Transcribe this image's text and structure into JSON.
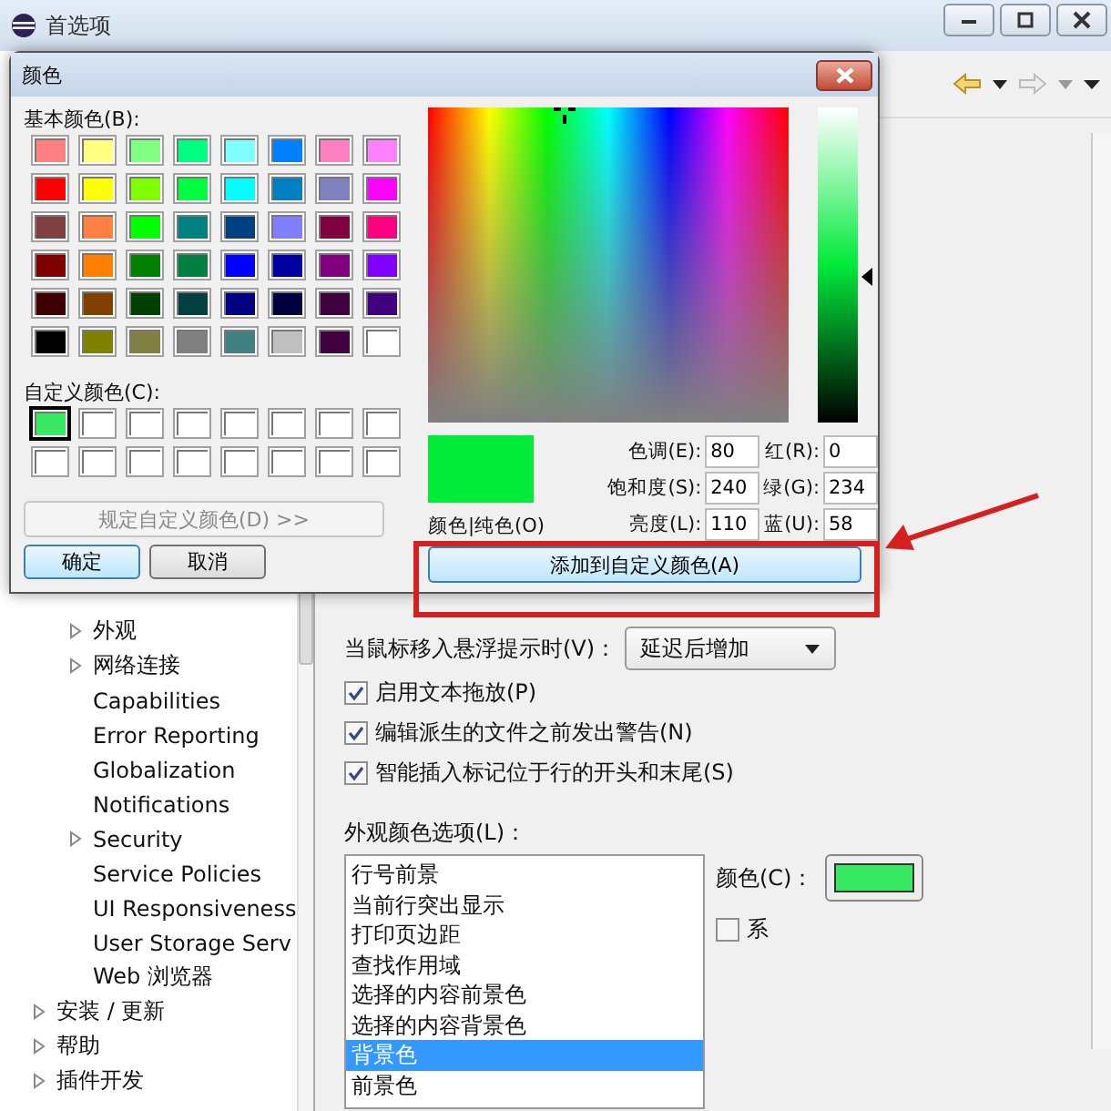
{
  "window": {
    "title": "首选项"
  },
  "tree": {
    "items": [
      {
        "children": [
          {
            "label": "外观",
            "expandable": true
          },
          {
            "label": "网络连接",
            "expandable": true
          },
          {
            "label": "Capabilities",
            "expandable": false
          },
          {
            "label": "Error Reporting",
            "expandable": false
          },
          {
            "label": "Globalization",
            "expandable": false
          },
          {
            "label": "Notifications",
            "expandable": false
          },
          {
            "label": "Security",
            "expandable": true
          },
          {
            "label": "Service Policies",
            "expandable": false
          },
          {
            "label": "UI Responsiveness",
            "expandable": false
          },
          {
            "label": "User Storage Serv",
            "expandable": false
          },
          {
            "label": "Web 浏览器",
            "expandable": false
          }
        ]
      },
      {
        "label": "安装 / 更新",
        "expandable": true
      },
      {
        "label": "帮助",
        "expandable": true
      },
      {
        "label": "插件开发",
        "expandable": true
      }
    ]
  },
  "editor": {
    "hover_label": "当鼠标移入悬浮提示时(V)：",
    "hover_select": "延迟后增加",
    "checkboxes": [
      {
        "label": "启用文本拖放(P)",
        "checked": true
      },
      {
        "label": "编辑派生的文件之前发出警告(N)",
        "checked": true
      },
      {
        "label": "智能插入标记位于行的开头和末尾(S)",
        "checked": true
      }
    ],
    "appearance_label": "外观颜色选项(L)：",
    "appearance_list": [
      {
        "label": "行号前景",
        "selected": false
      },
      {
        "label": "当前行突出显示",
        "selected": false
      },
      {
        "label": "打印页边距",
        "selected": false
      },
      {
        "label": "查找作用域",
        "selected": false
      },
      {
        "label": "选择的内容前景色",
        "selected": false
      },
      {
        "label": "选择的内容背景色",
        "selected": false
      },
      {
        "label": "背景色",
        "selected": true
      },
      {
        "label": "前景色",
        "selected": false
      }
    ],
    "color_label": "颜色(C)：",
    "color_button": {
      "color": "#38e862"
    },
    "default_checkbox": {
      "label": "系",
      "checked": false
    }
  },
  "dialog": {
    "title": "颜色",
    "basic_colors_label": "基本颜色(B):",
    "basic_colors": [
      {
        "color": "#ff8080"
      },
      {
        "color": "#ffff80"
      },
      {
        "color": "#80ff80"
      },
      {
        "color": "#00ff80"
      },
      {
        "color": "#80ffff"
      },
      {
        "color": "#0080ff"
      },
      {
        "color": "#ff80c0"
      },
      {
        "color": "#ff80ff"
      },
      {
        "color": "#ff0000"
      },
      {
        "color": "#ffff00"
      },
      {
        "color": "#80ff00"
      },
      {
        "color": "#00ff40"
      },
      {
        "color": "#00ffff"
      },
      {
        "color": "#0080c0"
      },
      {
        "color": "#8080c0"
      },
      {
        "color": "#ff00ff"
      },
      {
        "color": "#804040"
      },
      {
        "color": "#ff8040"
      },
      {
        "color": "#00ff00"
      },
      {
        "color": "#008080"
      },
      {
        "color": "#004080"
      },
      {
        "color": "#8080ff"
      },
      {
        "color": "#800040"
      },
      {
        "color": "#ff0080"
      },
      {
        "color": "#800000"
      },
      {
        "color": "#ff8000"
      },
      {
        "color": "#008000"
      },
      {
        "color": "#008040"
      },
      {
        "color": "#0000ff"
      },
      {
        "color": "#0000a0"
      },
      {
        "color": "#800080"
      },
      {
        "color": "#8000ff"
      },
      {
        "color": "#400000"
      },
      {
        "color": "#804000"
      },
      {
        "color": "#004000"
      },
      {
        "color": "#004040"
      },
      {
        "color": "#000080"
      },
      {
        "color": "#000040"
      },
      {
        "color": "#400040"
      },
      {
        "color": "#400080"
      },
      {
        "color": "#000000"
      },
      {
        "color": "#808000"
      },
      {
        "color": "#808040"
      },
      {
        "color": "#808080"
      },
      {
        "color": "#408080"
      },
      {
        "color": "#c0c0c0"
      },
      {
        "color": "#400040"
      },
      {
        "color": "#ffffff"
      }
    ],
    "custom_colors_label": "自定义颜色(C):",
    "custom_colors": [
      {
        "color": "#38e862",
        "selected": true
      },
      {
        "color": "#ffffff",
        "selected": false
      },
      {
        "color": "#ffffff",
        "selected": false
      },
      {
        "color": "#ffffff",
        "selected": false
      },
      {
        "color": "#ffffff",
        "selected": false
      },
      {
        "color": "#ffffff",
        "selected": false
      },
      {
        "color": "#ffffff",
        "selected": false
      },
      {
        "color": "#ffffff",
        "selected": false
      },
      {
        "color": "#ffffff",
        "selected": false
      },
      {
        "color": "#ffffff",
        "selected": false
      },
      {
        "color": "#ffffff",
        "selected": false
      },
      {
        "color": "#ffffff",
        "selected": false
      },
      {
        "color": "#ffffff",
        "selected": false
      },
      {
        "color": "#ffffff",
        "selected": false
      },
      {
        "color": "#ffffff",
        "selected": false
      },
      {
        "color": "#ffffff",
        "selected": false
      }
    ],
    "define_custom_button": {
      "label": "规定自定义颜色(D) >>",
      "disabled": true
    },
    "ok_button": "确定",
    "cancel_button": "取消",
    "luminance": {
      "level": 0.46
    },
    "preview": {
      "color": "#00ea3a",
      "label": "颜色|纯色(O)"
    },
    "fields": [
      {
        "label": "色调(E):",
        "value": "80"
      },
      {
        "label": "红(R):",
        "value": "0"
      },
      {
        "label": "饱和度(S):",
        "value": "240"
      },
      {
        "label": "绿(G):",
        "value": "234"
      },
      {
        "label": "亮度(L):",
        "value": "110"
      },
      {
        "label": "蓝(U):",
        "value": "58"
      }
    ],
    "add_button": "添加到自定义颜色(A)"
  }
}
